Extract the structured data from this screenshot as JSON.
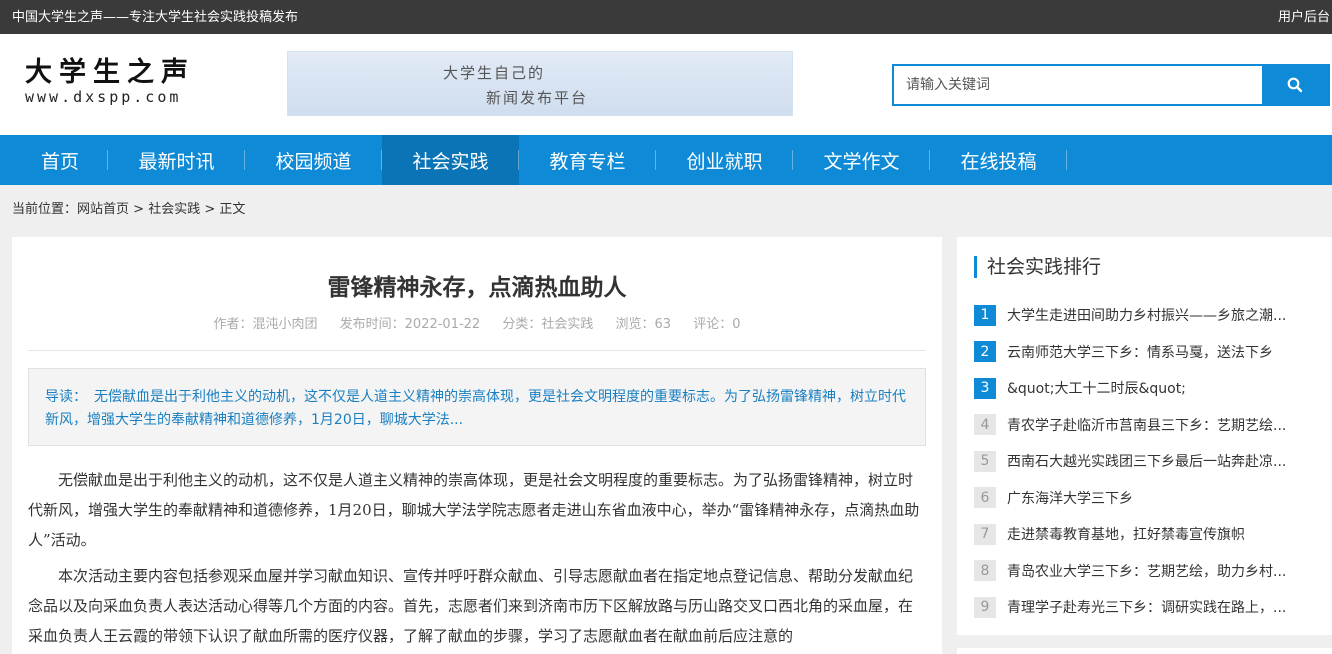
{
  "topbar": {
    "slogan": "中国大学生之声——专注大学生社会实践投稿发布",
    "admin": "用户后台"
  },
  "logo": {
    "cn": "大学生之声",
    "url": "www.dxspp.com"
  },
  "banner": {
    "line1": "大学生自己的",
    "line2": "新闻发布平台"
  },
  "search": {
    "placeholder": "请输入关键词",
    "icon": "search-icon"
  },
  "nav": {
    "items": [
      "首页",
      "最新时讯",
      "校园频道",
      "社会实践",
      "教育专栏",
      "创业就职",
      "文学作文",
      "在线投稿"
    ],
    "active": 3
  },
  "breadcrumb": {
    "prefix": "当前位置：",
    "home": "网站首页",
    "sep": " > ",
    "category": "社会实践",
    "current": "正文"
  },
  "article": {
    "title": "雷锋精神永存，点滴热血助人",
    "author": "作者：混沌小肉团",
    "date": "发布时间：2022-01-22",
    "category": "分类：社会实践",
    "views": "浏览：63",
    "comments": "评论：0",
    "lead": "导读：　无偿献血是出于利他主义的动机，这不仅是人道主义精神的崇高体现，更是社会文明程度的重要标志。为了弘扬雷锋精神，树立时代新风，增强大学生的奉献精神和道德修养，1月20日，聊城大学法...",
    "paragraphs": [
      "无偿献血是出于利他主义的动机，这不仅是人道主义精神的崇高体现，更是社会文明程度的重要标志。为了弘扬雷锋精神，树立时代新风，增强大学生的奉献精神和道德修养，1月20日，聊城大学法学院志愿者走进山东省血液中心，举办“雷锋精神永存，点滴热血助人”活动。",
      "本次活动主要内容包括参观采血屋并学习献血知识、宣传并呼吁群众献血、引导志愿献血者在指定地点登记信息、帮助分发献血纪念品以及向采血负责人表达活动心得等几个方面的内容。首先，志愿者们来到济南市历下区解放路与历山路交叉口西北角的采血屋，在采血负责人王云霞的带领下认识了献血所需的医疗仪器，了解了献血的步骤，学习了志愿献血者在献血前后应注意的"
    ]
  },
  "sidebar": {
    "heading": "社会实践排行",
    "items": [
      {
        "num": "1",
        "title": "大学生走进田间助力乡村振兴——乡旅之潮..."
      },
      {
        "num": "2",
        "title": "云南师范大学三下乡：情系马戛，送法下乡"
      },
      {
        "num": "3",
        "title": "&quot;大工十二时辰&quot;"
      },
      {
        "num": "4",
        "title": "青农学子赴临沂市莒南县三下乡：艺期艺绘..."
      },
      {
        "num": "5",
        "title": "西南石大越光实践团三下乡最后一站奔赴凉..."
      },
      {
        "num": "6",
        "title": "广东海洋大学三下乡"
      },
      {
        "num": "7",
        "title": "走进禁毒教育基地，扛好禁毒宣传旗帜"
      },
      {
        "num": "8",
        "title": "青岛农业大学三下乡：艺期艺绘，助力乡村..."
      },
      {
        "num": "9",
        "title": "青理学子赴寿光三下乡：调研实践在路上，..."
      }
    ]
  },
  "colors": {
    "brand": "#0e8ad6",
    "nav_active": "#0a74b6",
    "topbar": "#3a3a3a"
  }
}
